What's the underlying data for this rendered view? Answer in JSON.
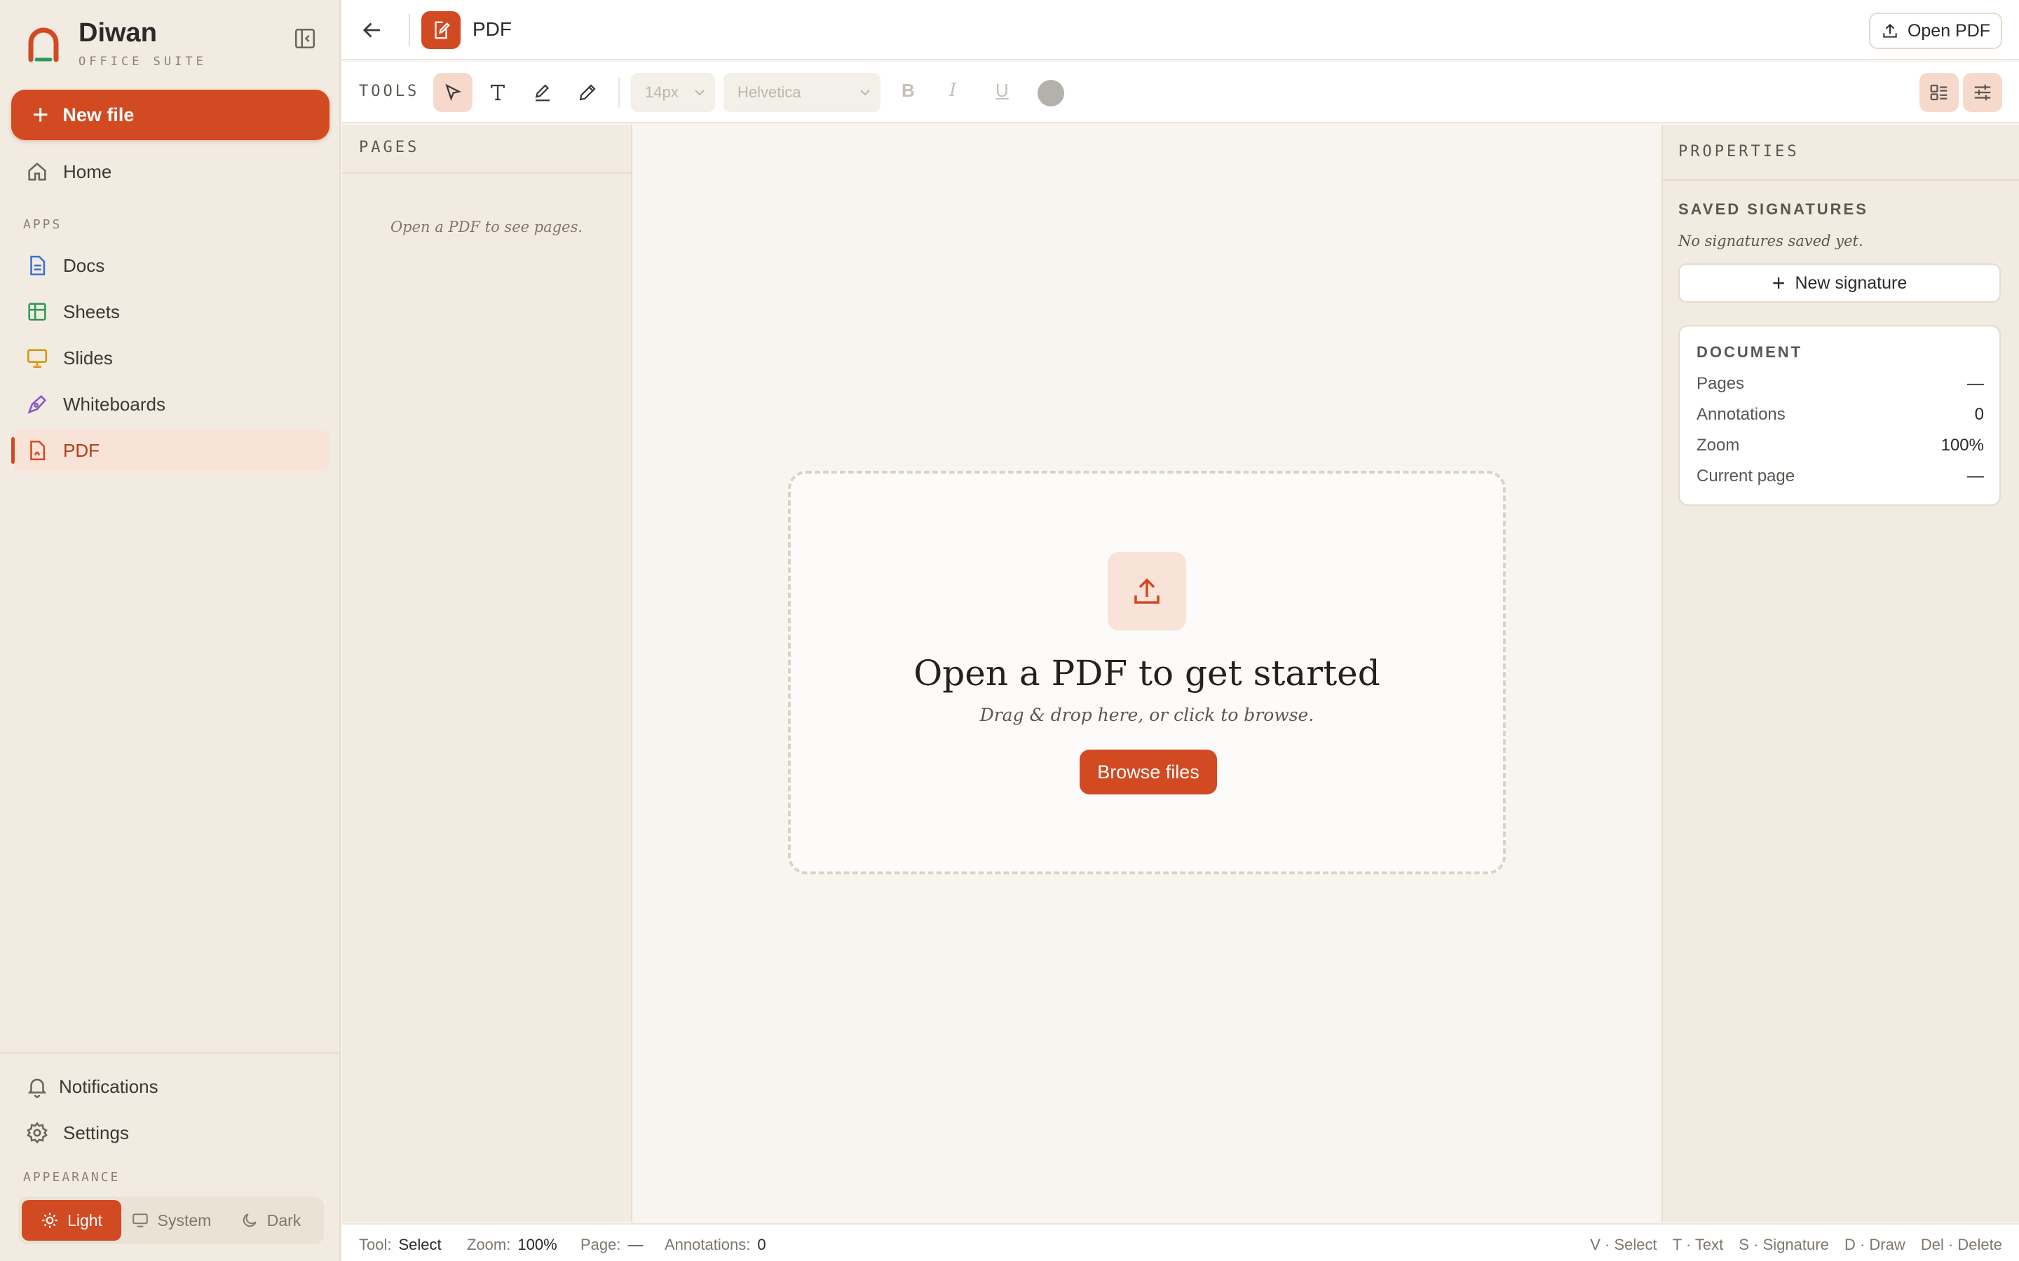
{
  "brand": {
    "name": "Diwan",
    "subtitle": "OFFICE SUITE"
  },
  "sidebar": {
    "new_file_label": "New file",
    "home_label": "Home",
    "apps_label": "APPS",
    "items": [
      {
        "label": "Docs",
        "icon": "doc-icon",
        "color": "#3b6fd4"
      },
      {
        "label": "Sheets",
        "icon": "sheet-icon",
        "color": "#2e9a5a"
      },
      {
        "label": "Slides",
        "icon": "slides-icon",
        "color": "#d8960f"
      },
      {
        "label": "Whiteboards",
        "icon": "whiteboard-icon",
        "color": "#8a55c9"
      },
      {
        "label": "PDF",
        "icon": "pdf-icon",
        "color": "#d24a22"
      }
    ],
    "notifications_label": "Notifications",
    "settings_label": "Settings",
    "appearance_label": "APPEARANCE",
    "appearance_options": [
      "Light",
      "System",
      "Dark"
    ],
    "appearance_selected": "Light"
  },
  "header": {
    "title": "PDF",
    "open_pdf_label": "Open PDF"
  },
  "toolbar": {
    "tools_label": "TOOLS",
    "active_tool": "select",
    "font_size": "14px",
    "font_family": "Helvetica",
    "bold": "B",
    "italic": "I",
    "underline": "U"
  },
  "pages_panel": {
    "title": "PAGES",
    "empty_text": "Open a PDF to see pages."
  },
  "dropzone": {
    "title": "Open a PDF to get started",
    "subtitle": "Drag & drop here, or click to browse.",
    "button_label": "Browse files"
  },
  "properties": {
    "title": "PROPERTIES",
    "signatures_title": "SAVED SIGNATURES",
    "no_signatures": "No signatures saved yet.",
    "new_signature_label": "New signature",
    "document_title": "DOCUMENT",
    "document_rows": [
      {
        "key": "Pages",
        "value": "—"
      },
      {
        "key": "Annotations",
        "value": "0"
      },
      {
        "key": "Zoom",
        "value": "100%"
      },
      {
        "key": "Current page",
        "value": "—"
      }
    ]
  },
  "status": {
    "tool_label": "Tool:",
    "tool_value": "Select",
    "zoom_label": "Zoom:",
    "zoom_value": "100%",
    "page_label": "Page:",
    "page_value": "—",
    "annotations_label": "Annotations:",
    "annotations_value": "0",
    "shortcuts": [
      "V · Select",
      "T · Text",
      "S · Signature",
      "D · Draw",
      "Del · Delete"
    ]
  },
  "colors": {
    "accent": "#d24a22",
    "sidebar_bg": "#f2ebe1",
    "canvas_bg": "#f8f5f0"
  }
}
